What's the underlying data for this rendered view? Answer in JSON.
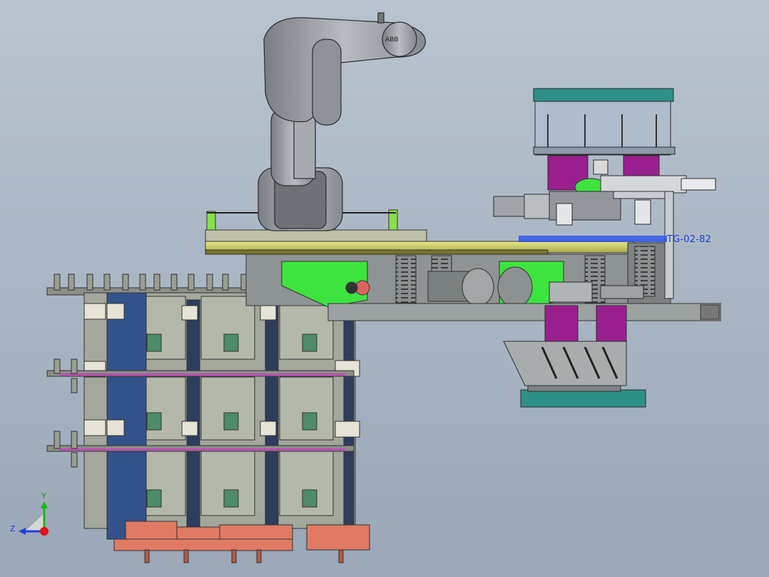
{
  "scene": {
    "part_label": "TG-02-82",
    "robot_brand": "ABB"
  },
  "triad": {
    "y_label": "Y",
    "z_label": "Z",
    "colors": {
      "y": "#16b816",
      "z": "#1d3de0",
      "x": "#e01414"
    }
  },
  "colors": {
    "background_top": "#b9c3cf",
    "background_bottom": "#9aa7b7",
    "robot": "#9a9ea3",
    "plate_yellow": "#cfcf60",
    "green_part": "#3ee43e",
    "magenta_part": "#9a1f8e",
    "teal_part": "#2e8f86",
    "salmon_part": "#e07a63",
    "blue_column": "#33528a",
    "frame_gray": "#a7ab9f",
    "machine_gray": "#8e9393"
  }
}
